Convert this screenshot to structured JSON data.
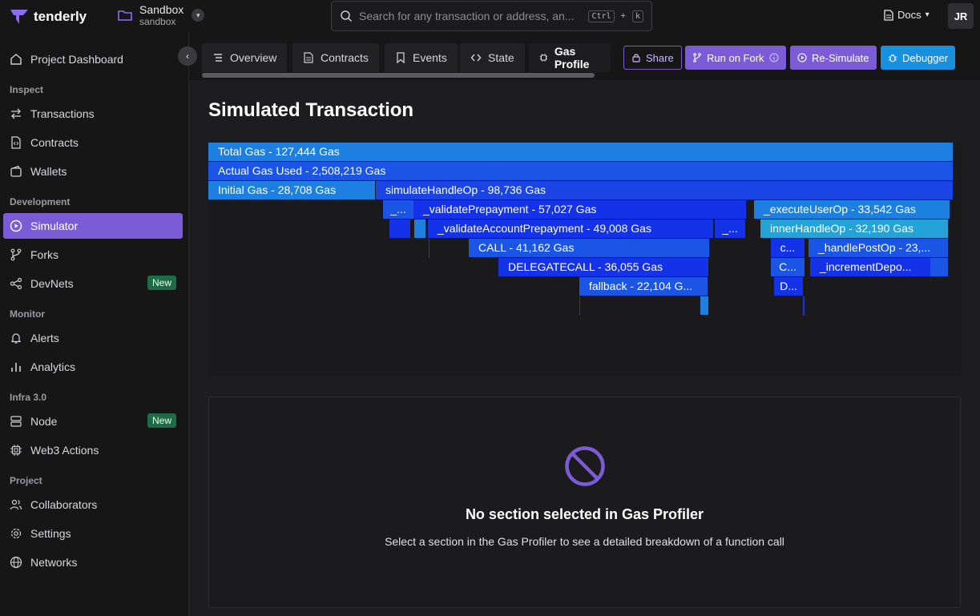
{
  "app": {
    "name": "tenderly"
  },
  "project": {
    "name": "Sandbox",
    "slug": "sandbox"
  },
  "search": {
    "placeholder": "Search for any transaction or address, an...",
    "kbd_ctrl": "Ctrl",
    "kbd_plus": "+",
    "kbd_key": "k"
  },
  "header": {
    "docs": "Docs",
    "avatar": "JR"
  },
  "sidebar": {
    "top_item": "Project Dashboard",
    "sections": {
      "inspect": "Inspect",
      "development": "Development",
      "monitor": "Monitor",
      "infra": "Infra 3.0",
      "project": "Project"
    },
    "items": {
      "transactions": "Transactions",
      "contracts": "Contracts",
      "wallets": "Wallets",
      "simulator": "Simulator",
      "forks": "Forks",
      "devnets": "DevNets",
      "alerts": "Alerts",
      "analytics": "Analytics",
      "node": "Node",
      "web3_actions": "Web3 Actions",
      "collaborators": "Collaborators",
      "settings": "Settings",
      "networks": "Networks"
    },
    "new_badge": "New"
  },
  "tabs": {
    "overview": "Overview",
    "contracts": "Contracts",
    "events": "Events",
    "state": "State",
    "gas_profiler": "Gas Profile"
  },
  "actions": {
    "share": "Share",
    "run_on_fork": "Run on Fork",
    "re_simulate": "Re-Simulate",
    "debugger": "Debugger"
  },
  "page_title": "Simulated Transaction",
  "flame_graph": {
    "total": "Total Gas - 127,444 Gas",
    "actual": "Actual Gas Used - 2,508,219 Gas",
    "initial": "Initial Gas - 28,708 Gas",
    "simulate_handle_op": "simulateHandleOp - 98,736 Gas",
    "collapsed_1": "_...",
    "validate_prepayment": "_validatePrepayment - 57,027 Gas",
    "execute_user_op": "_executeUserOp - 33,542 Gas",
    "validate_account_prepayment": "_validateAccountPrepayment - 49,008 Gas",
    "collapsed_2": "_...",
    "inner_handle_op": "innerHandleOp - 32,190 Gas",
    "call": "CALL - 41,162 Gas",
    "collapsed_c": "c...",
    "handle_post_op": "_handlePostOp - 23,...",
    "delegatecall": "DELEGATECALL - 36,055 Gas",
    "collapsed_C": "C...",
    "increment_deposit": "_incrementDepo...",
    "fallback": "fallback - 22,104 G...",
    "collapsed_D": "D..."
  },
  "empty_state": {
    "title": "No section selected in Gas Profiler",
    "description": "Select a section in the Gas Profiler to see a detailed breakdown of a function call"
  },
  "colors": {
    "accent": "#7b5cd6",
    "debugger": "#1890e0",
    "flame_light": "#1d7fe0",
    "flame_mid": "#1a55e6",
    "flame_dark": "#1432e8",
    "flame_cyan": "#25a3d8"
  }
}
